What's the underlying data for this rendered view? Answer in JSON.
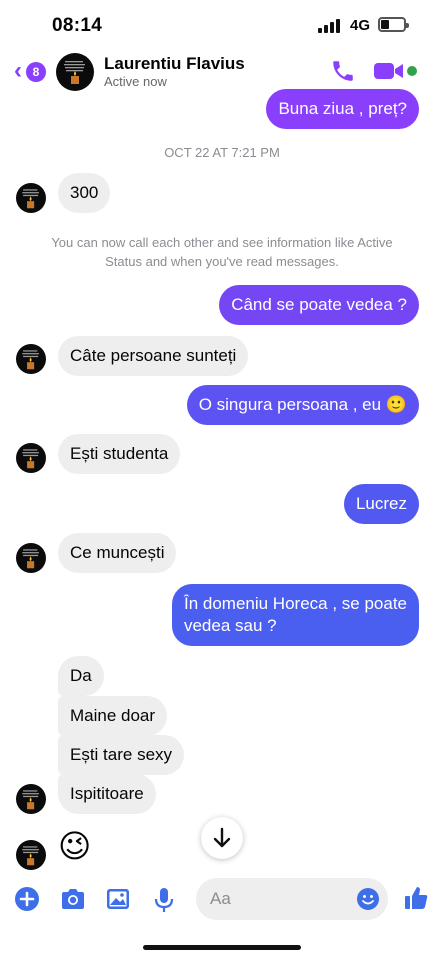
{
  "status_bar": {
    "time": "08:14",
    "network": "4G"
  },
  "header": {
    "unread_count": "8",
    "contact_name": "Laurentiu Flavius",
    "contact_status": "Active now"
  },
  "messages": [
    {
      "dir": "out",
      "text": "Buna ziua , preț?"
    },
    {
      "type": "timestamp",
      "text": "OCT 22 AT 7:21 PM"
    },
    {
      "dir": "in",
      "text": "300"
    },
    {
      "type": "system",
      "lines": [
        "You can now call each other and see information like Active",
        "Status and when you've read messages."
      ]
    },
    {
      "dir": "out",
      "text": "Când se poate vedea ?"
    },
    {
      "dir": "in",
      "text": "Câte persoane sunteți"
    },
    {
      "dir": "out",
      "text": "O singura persoana , eu 🙂"
    },
    {
      "dir": "in",
      "text": "Ești studenta"
    },
    {
      "dir": "out",
      "text": "Lucrez"
    },
    {
      "dir": "in",
      "text": "Ce muncești"
    },
    {
      "dir": "out",
      "lines": [
        "În domeniu Horeca , se poate",
        "vedea sau ?"
      ]
    },
    {
      "dir": "in",
      "text": "Da"
    },
    {
      "dir": "in",
      "text": "Maine doar"
    },
    {
      "dir": "in",
      "text": "Ești tare sexy"
    },
    {
      "dir": "in",
      "text": "Ispititoare"
    },
    {
      "dir": "in",
      "text": "😉",
      "kind": "emoji"
    }
  ],
  "composer": {
    "placeholder": "Aa"
  },
  "icons": {
    "back": "chevron-left-icon",
    "call": "phone-icon",
    "video": "video-camera-icon",
    "add": "plus-icon",
    "camera": "camera-icon",
    "gallery": "image-icon",
    "mic": "microphone-icon",
    "emoji": "smiley-icon",
    "like": "thumbs-up-icon",
    "scroll": "arrow-down-icon"
  },
  "colors": {
    "accent": "#8a3ffc",
    "bubble_purple": "#8a3ffc",
    "bubble_blue": "#4a5ef0",
    "incoming": "#eeeeef",
    "icon_blue": "#3f6fe8",
    "online": "#31a24c"
  }
}
